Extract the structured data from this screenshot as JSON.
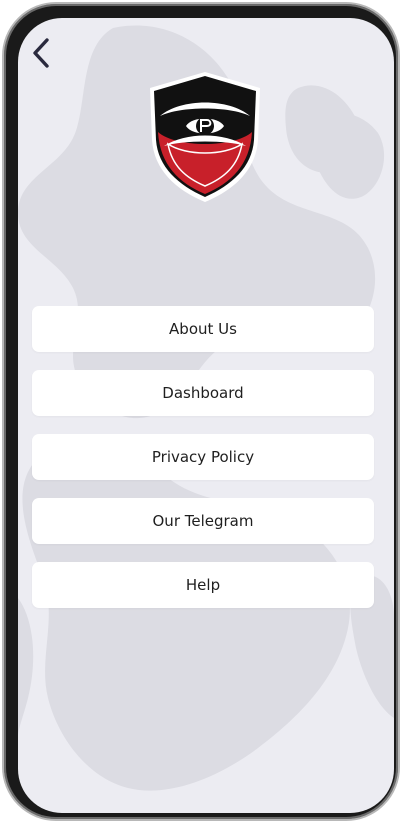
{
  "header": {
    "back_icon": "chevron-left-icon"
  },
  "logo": {
    "icon": "shield-logo-icon",
    "colors": {
      "shield_dark": "#111111",
      "shield_red": "#c8202a",
      "shield_border": "#ffffff"
    }
  },
  "menu": {
    "items": [
      {
        "label": "About Us"
      },
      {
        "label": "Dashboard"
      },
      {
        "label": "Privacy Policy"
      },
      {
        "label": "Our Telegram"
      },
      {
        "label": "Help"
      }
    ]
  },
  "theme": {
    "screen_background": "#ececf2",
    "button_background": "#ffffff",
    "text_color": "#1f1f1f",
    "icon_color": "#2a2a3e"
  }
}
